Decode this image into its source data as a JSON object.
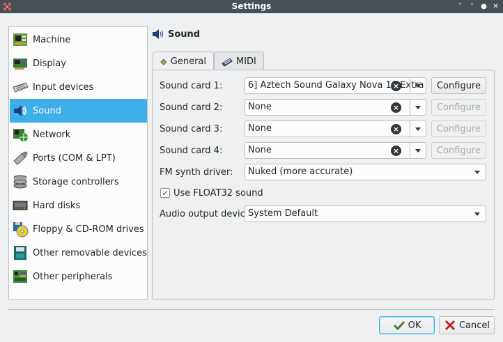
{
  "window": {
    "title": "Settings",
    "buttons": [
      "˅",
      "˄",
      "●",
      "✕"
    ]
  },
  "sidebar": {
    "items": [
      {
        "label": "Machine",
        "icon": "machine-chip-icon"
      },
      {
        "label": "Display",
        "icon": "display-card-icon"
      },
      {
        "label": "Input devices",
        "icon": "keyboard-icon"
      },
      {
        "label": "Sound",
        "icon": "speaker-icon",
        "active": true
      },
      {
        "label": "Network",
        "icon": "network-card-icon"
      },
      {
        "label": "Ports (COM & LPT)",
        "icon": "port-connector-icon"
      },
      {
        "label": "Storage controllers",
        "icon": "disk-stack-icon"
      },
      {
        "label": "Hard disks",
        "icon": "hard-disk-icon"
      },
      {
        "label": "Floppy & CD-ROM drives",
        "icon": "floppy-cdrom-icon"
      },
      {
        "label": "Other removable devices",
        "icon": "removable-device-icon"
      },
      {
        "label": "Other peripherals",
        "icon": "peripheral-board-icon"
      }
    ]
  },
  "header": {
    "title": "Sound",
    "icon": "speaker-icon"
  },
  "tabs": [
    {
      "label": "General",
      "icon": "gear-icon",
      "active": true
    },
    {
      "label": "MIDI",
      "icon": "midi-keyboard-icon"
    }
  ],
  "general": {
    "sound_cards": [
      {
        "label": "Sound card 1:",
        "value": "6] Aztech Sound Galaxy Nova 16 Extra",
        "configure": "Configure",
        "configure_enabled": true
      },
      {
        "label": "Sound card 2:",
        "value": "None",
        "configure": "Configure",
        "configure_enabled": false
      },
      {
        "label": "Sound card 3:",
        "value": "None",
        "configure": "Configure",
        "configure_enabled": false
      },
      {
        "label": "Sound card 4:",
        "value": "None",
        "configure": "Configure",
        "configure_enabled": false
      }
    ],
    "fm_synth": {
      "label": "FM synth driver:",
      "value": "Nuked (more accurate)"
    },
    "float32": {
      "label": "Use FLOAT32 sound",
      "checked": true,
      "mark": "✓"
    },
    "audio_output": {
      "label": "Audio output device:",
      "value": "System Default"
    }
  },
  "dialog": {
    "ok": "OK",
    "cancel": "Cancel"
  },
  "colors": {
    "accent": "#3daee9",
    "titlebar": "#475057",
    "background": "#eff0f1"
  }
}
